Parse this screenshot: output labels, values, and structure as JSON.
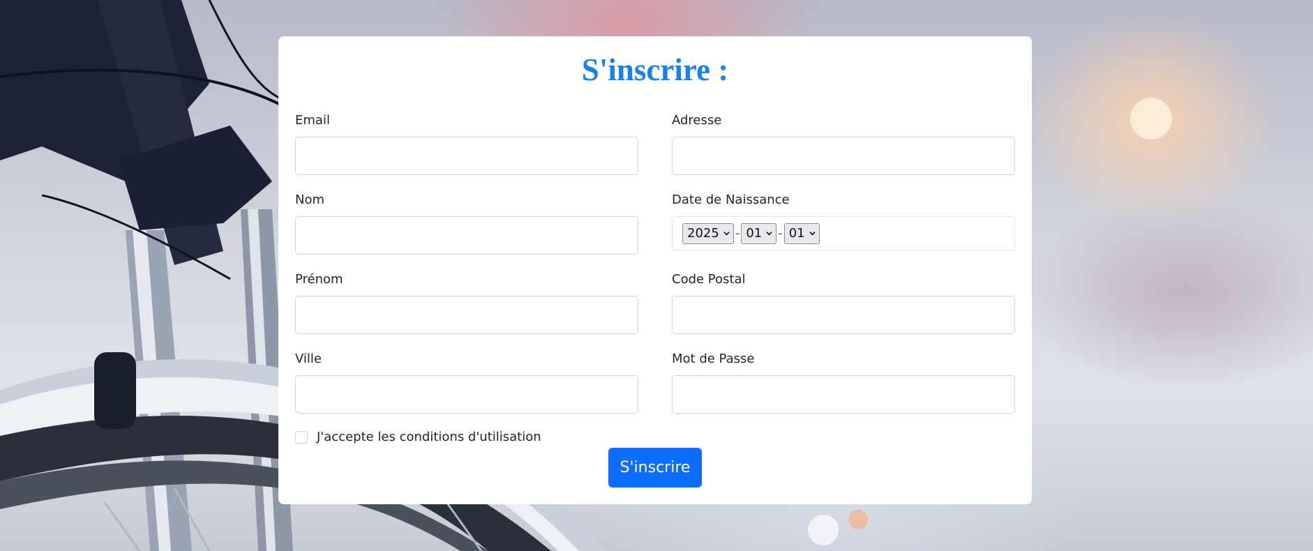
{
  "form": {
    "title": "S'inscrire :",
    "fields": {
      "email": {
        "label": "Email",
        "value": ""
      },
      "adresse": {
        "label": "Adresse",
        "value": ""
      },
      "nom": {
        "label": "Nom",
        "value": ""
      },
      "date_naissance": {
        "label": "Date de Naissance",
        "year": "2025",
        "month": "01",
        "day": "01",
        "separator": "-"
      },
      "prenom": {
        "label": "Prénom",
        "value": ""
      },
      "code_postal": {
        "label": "Code Postal",
        "value": ""
      },
      "ville": {
        "label": "Ville",
        "value": ""
      },
      "mot_de_passe": {
        "label": "Mot de Passe",
        "value": ""
      }
    },
    "terms_label": "J'accepte les conditions d'utilisation",
    "terms_checked": false,
    "submit_label": "S'inscrire"
  },
  "colors": {
    "title": "#1a80ef",
    "primary_button": "#0d6efd"
  }
}
